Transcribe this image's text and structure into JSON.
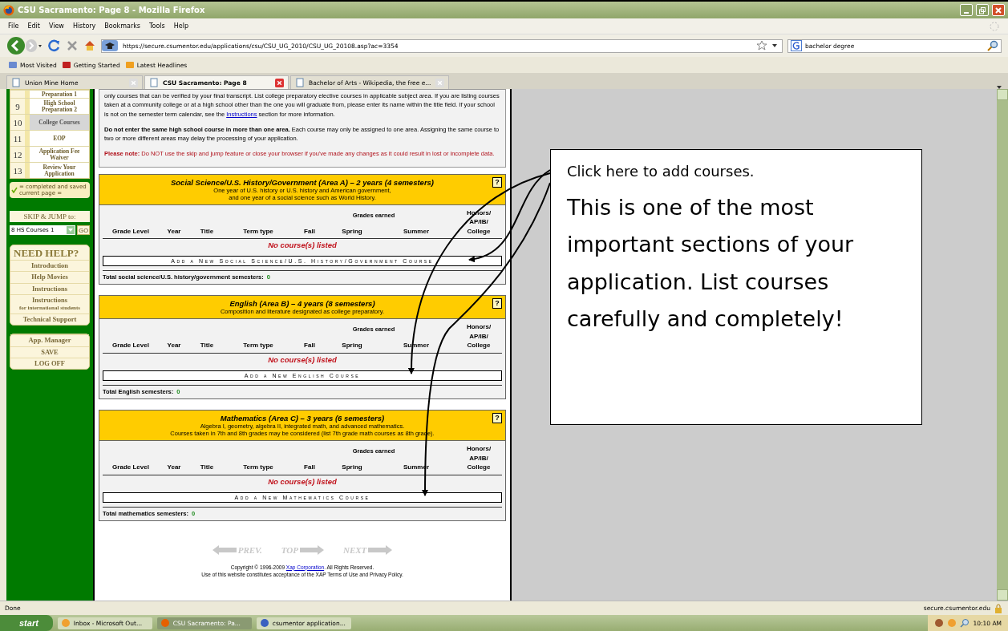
{
  "window": {
    "title": "CSU Sacramento: Page 8 - Mozilla Firefox"
  },
  "menu": [
    "File",
    "Edit",
    "View",
    "History",
    "Bookmarks",
    "Tools",
    "Help"
  ],
  "address": {
    "value": "https://secure.csumentor.edu/applications/csu/CSU_UG_2010/CSU_UG_20108.asp?ac=3354"
  },
  "search": {
    "value": "bachelor degree"
  },
  "bookmarks": [
    "Most Visited",
    "Getting Started",
    "Latest Headlines"
  ],
  "tabs": [
    {
      "label": "Union Mine Home",
      "selected": false
    },
    {
      "label": "CSU Sacramento: Page 8",
      "selected": true
    },
    {
      "label": "Bachelor of Arts - Wikipedia, the free e...",
      "selected": false
    }
  ],
  "sidebar": {
    "steps": [
      {
        "label": "Preparation 1",
        "selected": false
      },
      {
        "number": "9",
        "label": "High School Preparation 2",
        "selected": false
      },
      {
        "number": "10",
        "label": "College Courses",
        "selected": true
      },
      {
        "number": "11",
        "label": "EOP",
        "selected": false
      },
      {
        "number": "12",
        "label": "Application Fee Waiver",
        "selected": false
      },
      {
        "number": "13",
        "label": "Review Your Application",
        "selected": false
      }
    ],
    "legend": [
      "= completed and saved",
      "current page ="
    ],
    "skip_jump": {
      "label": "SKIP & JUMP to:",
      "value": "8 HS Courses 1",
      "button": "GO"
    },
    "help": {
      "logo": "NEED HELP?",
      "items": [
        "Introduction",
        "Help Movies",
        "Instructions"
      ],
      "intl": {
        "label": "Instructions",
        "note": "for international students"
      },
      "support": "Technical Support"
    },
    "account": [
      "App. Manager",
      "SAVE",
      "LOG OFF"
    ]
  },
  "notice": {
    "intro_before": "only courses that can be verified by your final transcript. List college preparatory elective courses in applicable subject area. If you are listing courses taken at a community college or at a high school other than the one you will graduate from, please enter its name within the title field. If your school is not on the semester term calendar, see the",
    "intro_link": "Instructions",
    "intro_after": "section for more information.",
    "warning": "**Do not enter the same high school course in more than one area.** Each course may only be assigned to one area. Assigning the same course to two or more different areas may delay the processing of your application.",
    "note": "**Please note:** Do NOT use the skip and jump feature or close your browser if you've made any changes as it could result in lost or incomplete data."
  },
  "sections": [
    {
      "title": "Social Science/U.S. History/Government (Area A) – 2 years (4 semesters)",
      "description": [
        "One year of U.S. history or U.S. history and American government,",
        "and one year of a social science such as World History."
      ],
      "help_mark": "?",
      "group_header": "Grades earned",
      "columns": [
        "Grade Level",
        "Year",
        "Title",
        "Term type",
        "Fall",
        "Spring",
        "Summer",
        "Honors/ AP/IB/ College"
      ],
      "empty": "No course(s) listed",
      "add_button": "Add a New Social Science/U.S. History/Government Course",
      "total_label": "Total social science/U.S. history/government semesters:",
      "total": "0"
    },
    {
      "title": "English (Area B) – 4 years (8 semesters)",
      "description": [
        "Composition and literature designated as college preparatory."
      ],
      "help_mark": "?",
      "group_header": "Grades earned",
      "columns": [
        "Grade Level",
        "Year",
        "Title",
        "Term type",
        "Fall",
        "Spring",
        "Summer",
        "Honors/ AP/IB/ College"
      ],
      "empty": "No course(s) listed",
      "add_button": "Add a New English Course",
      "total_label": "Total English semesters:",
      "total": "0"
    },
    {
      "title": "Mathematics (Area C) – 3 years (6 semesters)",
      "description": [
        "Algebra I, geometry, algebra II, integrated math, and advanced mathematics.",
        "Courses taken in 7th and 8th grades may be considered (list 7th grade math courses as 8th grade)."
      ],
      "help_mark": "?",
      "group_header": "Grades earned",
      "columns": [
        "Grade Level",
        "Year",
        "Title",
        "Term type",
        "Fall",
        "Spring",
        "Summer",
        "Honors/ AP/IB/ College"
      ],
      "empty": "No course(s) listed",
      "add_button": "Add a New Mathematics Course",
      "total_label": "Total mathematics semesters:",
      "total": "0"
    }
  ],
  "page_nav": [
    "PREV.",
    "TOP",
    "NEXT"
  ],
  "footer": {
    "before": "Copyright © 1996-2009",
    "link": "Xap Corporation",
    "after": ". All Rights Reserved.",
    "terms": "Use of this website constitutes acceptance of the XAP Terms of Use and Privacy Policy."
  },
  "callout": {
    "heading": "Click here to add courses.",
    "body": "This is one of the most important sections of your application.  List courses carefully and completely!"
  },
  "status": {
    "text": "Done",
    "domain": "secure.csumentor.edu"
  },
  "taskbar": {
    "start": "start",
    "items": [
      {
        "label": "Inbox - Microsoft Out...",
        "selected": false
      },
      {
        "label": "CSU Sacramento: Pa...",
        "selected": true
      },
      {
        "label": "csumentor application...",
        "selected": false
      }
    ],
    "clock": "10:10 AM"
  }
}
